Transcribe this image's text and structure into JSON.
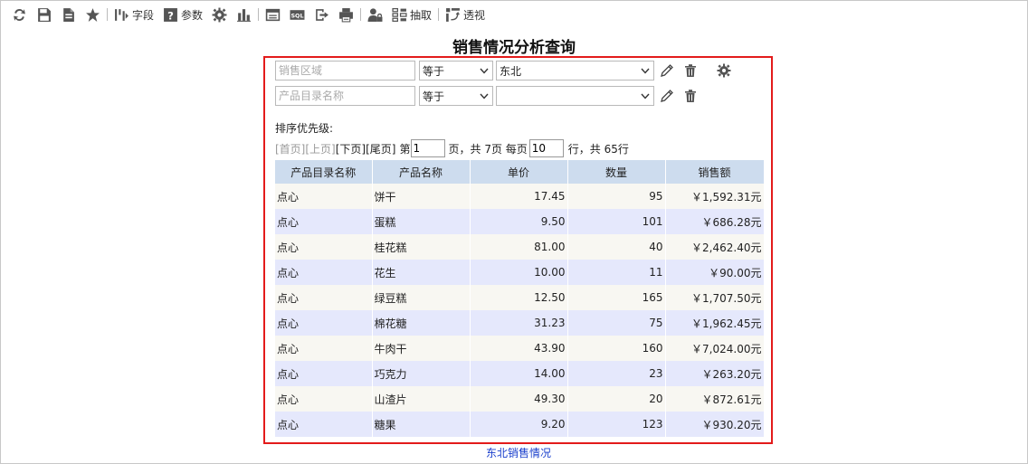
{
  "toolbar": {
    "field_label": "字段",
    "param_label": "参数",
    "extract_label": "抽取",
    "pivot_label": "透视",
    "sql_text": "SQL"
  },
  "report": {
    "title": "销售情况分析查询",
    "footer_link": "东北销售情况"
  },
  "conditions": [
    {
      "field_placeholder": "销售区域",
      "operator": "等于",
      "value": "东北"
    },
    {
      "field_placeholder": "产品目录名称",
      "operator": "等于",
      "value": ""
    }
  ],
  "sort_label": "排序优先级:",
  "pager": {
    "first": "[首页]",
    "prev": "[上页]",
    "next": "[下页]",
    "last": "[尾页]",
    "page_prefix": "第",
    "page_value": "1",
    "page_suffix": "页，共 7页 每页",
    "rows_value": "10",
    "rows_suffix": "行，共 65行"
  },
  "table": {
    "headers": [
      "产品目录名称",
      "产品名称",
      "单价",
      "数量",
      "销售额"
    ],
    "rows": [
      [
        "点心",
        "饼干",
        "17.45",
        "95",
        "￥1,592.31元"
      ],
      [
        "点心",
        "蛋糕",
        "9.50",
        "101",
        "￥686.28元"
      ],
      [
        "点心",
        "桂花糕",
        "81.00",
        "40",
        "￥2,462.40元"
      ],
      [
        "点心",
        "花生",
        "10.00",
        "11",
        "￥90.00元"
      ],
      [
        "点心",
        "绿豆糕",
        "12.50",
        "165",
        "￥1,707.50元"
      ],
      [
        "点心",
        "棉花糖",
        "31.23",
        "75",
        "￥1,962.45元"
      ],
      [
        "点心",
        "牛肉干",
        "43.90",
        "160",
        "￥7,024.00元"
      ],
      [
        "点心",
        "巧克力",
        "14.00",
        "23",
        "￥263.20元"
      ],
      [
        "点心",
        "山渣片",
        "49.30",
        "20",
        "￥872.61元"
      ],
      [
        "点心",
        "糖果",
        "9.20",
        "123",
        "￥930.20元"
      ]
    ]
  },
  "colors": {
    "panel_border": "#e31b1b",
    "header_bg": "#cddcee",
    "row_odd": "#f8f7f2",
    "row_even": "#e5e8fc",
    "link": "#1a3fcc"
  }
}
